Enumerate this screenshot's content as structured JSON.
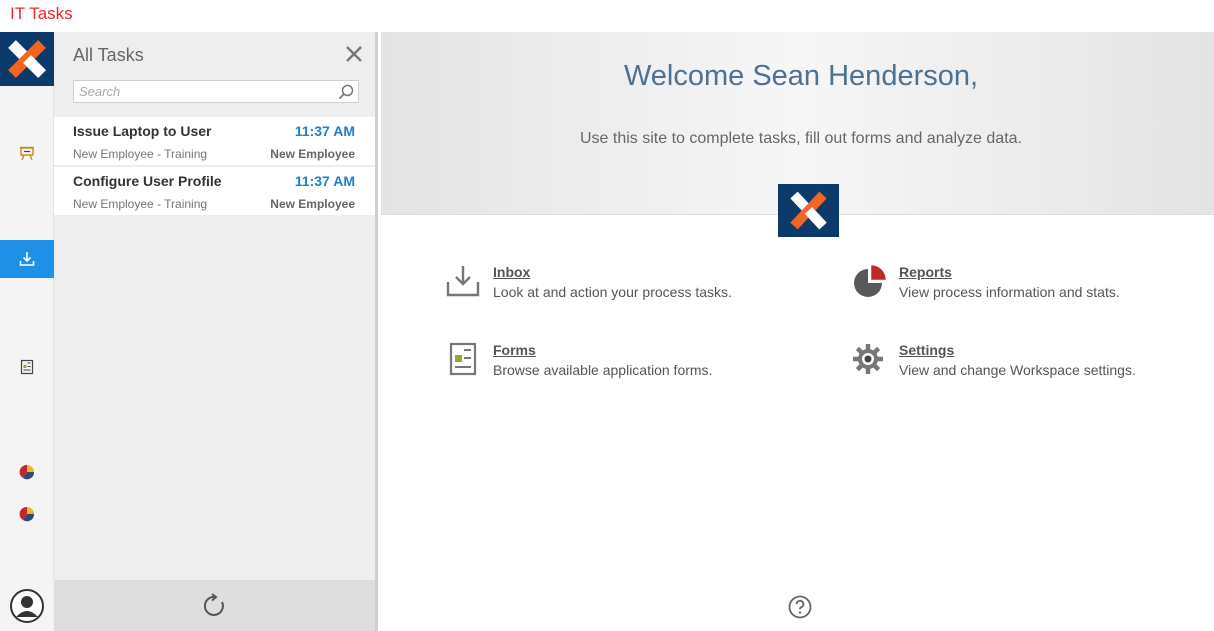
{
  "window": {
    "title": "IT Tasks"
  },
  "task_panel": {
    "title": "All Tasks",
    "search_placeholder": "Search",
    "tasks": [
      {
        "name": "Issue Laptop to User",
        "time": "11:37 AM",
        "process": "New Employee - Training",
        "category": "New Employee"
      },
      {
        "name": "Configure User Profile",
        "time": "11:37 AM",
        "process": "New Employee - Training",
        "category": "New Employee"
      }
    ]
  },
  "main": {
    "welcome": "Welcome Sean Henderson,",
    "subtitle": "Use this site to complete tasks, fill out forms and analyze data.",
    "tiles": {
      "inbox": {
        "title": "Inbox",
        "desc": "Look at and action your process tasks."
      },
      "reports": {
        "title": "Reports",
        "desc": "View process information and stats."
      },
      "forms": {
        "title": "Forms",
        "desc": "Browse available application forms."
      },
      "settings": {
        "title": "Settings",
        "desc": "View and change Workspace settings."
      }
    }
  },
  "colors": {
    "brand_navy": "#0c3a6a",
    "brand_orange": "#f26522",
    "accent_blue": "#1e90e6",
    "title_red": "#e8292d"
  },
  "icons": {
    "rail": [
      "easel-icon",
      "inbox-download-icon",
      "form-document-icon",
      "pie-chart-icon",
      "pie-chart-icon",
      "user-avatar-icon"
    ],
    "panel": [
      "close-icon",
      "search-icon",
      "refresh-icon"
    ],
    "main": [
      "inbox-icon",
      "reports-pie-icon",
      "forms-icon",
      "settings-gear-icon",
      "help-icon"
    ]
  }
}
